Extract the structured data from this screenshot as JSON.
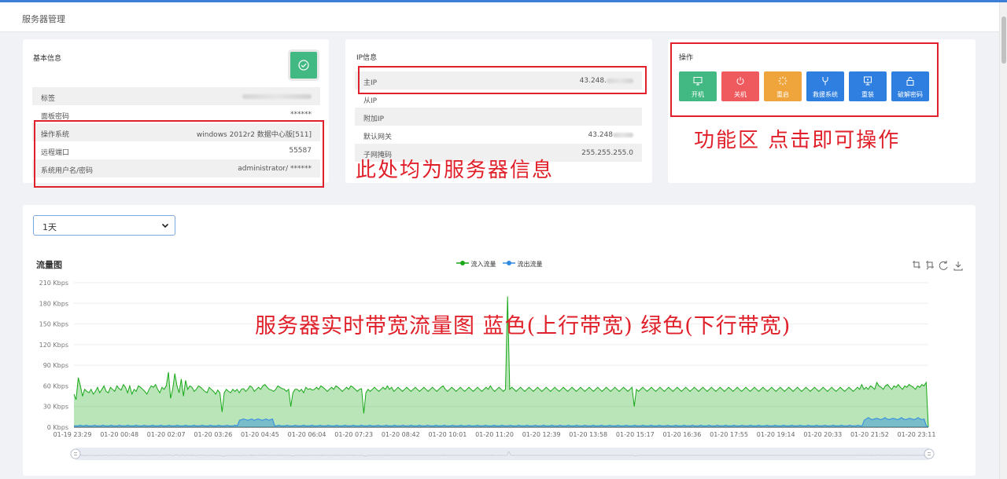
{
  "page": {
    "title": "服务器管理"
  },
  "basic_info": {
    "title": "基本信息",
    "rows": [
      {
        "label": "标签",
        "value": ""
      },
      {
        "label": "面板密码",
        "value": "******"
      },
      {
        "label": "操作系统",
        "value": "windows 2012r2 数据中心版[511]"
      },
      {
        "label": "远程端口",
        "value": "55587"
      },
      {
        "label": "系统用户名/密码",
        "value": "administrator/ ******"
      }
    ]
  },
  "ip_info": {
    "title": "IP信息",
    "rows": [
      {
        "label": "主IP",
        "value": "43.248."
      },
      {
        "label": "从IP",
        "value": ""
      },
      {
        "label": "附加IP",
        "value": ""
      },
      {
        "label": "默认网关",
        "value": "43.248"
      },
      {
        "label": "子网掩码",
        "value": "255.255.255.0"
      }
    ]
  },
  "operations": {
    "title": "操作",
    "buttons": [
      {
        "label": "开机",
        "color": "#42b983",
        "icon": "monitor-icon"
      },
      {
        "label": "关机",
        "color": "#ef5a5f",
        "icon": "power-icon"
      },
      {
        "label": "重启",
        "color": "#f0a43c",
        "icon": "spinner-icon"
      },
      {
        "label": "救援系统",
        "color": "#2f7fe0",
        "icon": "tool-icon"
      },
      {
        "label": "重装",
        "color": "#2f7fe0",
        "icon": "screen-icon"
      },
      {
        "label": "破解密码",
        "color": "#2f7fe0",
        "icon": "unlock-icon"
      }
    ]
  },
  "annotations": {
    "server_info": "此处均为服务器信息",
    "function_area": "功能区  点击即可操作",
    "bandwidth": "服务器实时带宽流量图 蓝色(上行带宽) 绿色(下行带宽)"
  },
  "range_select": {
    "value": "1天"
  },
  "chart_data": {
    "type": "area",
    "title": "流量图",
    "ylabel": "",
    "xlabel": "",
    "ylim": [
      0,
      210
    ],
    "y_unit": "Kbps",
    "y_ticks": [
      "0 Kbps",
      "30 Kbps",
      "60 Kbps",
      "90 Kbps",
      "120 Kbps",
      "150 Kbps",
      "180 Kbps",
      "210 Kbps"
    ],
    "x_ticks": [
      "01-19 23:29",
      "01-20 00:48",
      "01-20 02:07",
      "01-20 03:26",
      "01-20 04:45",
      "01-20 06:04",
      "01-20 07:23",
      "01-20 08:42",
      "01-20 10:01",
      "01-20 11:20",
      "01-20 12:39",
      "01-20 13:58",
      "01-20 15:17",
      "01-20 16:36",
      "01-20 17:55",
      "01-20 19:14",
      "01-20 20:33",
      "01-20 21:52",
      "01-20 23:11"
    ],
    "legend_position": "top-center",
    "series": [
      {
        "name": "流入流量",
        "color": "#18a818",
        "values": [
          48,
          40,
          72,
          60,
          45,
          55,
          52,
          50,
          55,
          48,
          52,
          58,
          50,
          55,
          60,
          52,
          50,
          58,
          55,
          52,
          60,
          56,
          54,
          62,
          58,
          50,
          60,
          48,
          55,
          52,
          60,
          58,
          55,
          52,
          48,
          55,
          60,
          58,
          62,
          55,
          50,
          58,
          55,
          60,
          80,
          42,
          55,
          78,
          60,
          50,
          70,
          45,
          68,
          55,
          60,
          58,
          52,
          55,
          60,
          58,
          55,
          52,
          50,
          58,
          55,
          52,
          48,
          54,
          50,
          22,
          50,
          55,
          52,
          50,
          55,
          52,
          55,
          50,
          55,
          56,
          52,
          55,
          60,
          58,
          52,
          55,
          58,
          55,
          60,
          62,
          58,
          55,
          54,
          52,
          55,
          60,
          58,
          56,
          55,
          52,
          55,
          30,
          50,
          55,
          55,
          52,
          55,
          50,
          58,
          55,
          56,
          54,
          55,
          58,
          55,
          60,
          58,
          55,
          52,
          55,
          58,
          55,
          60,
          58,
          55,
          52,
          55,
          58,
          55,
          60,
          58,
          55,
          52,
          55,
          56,
          20,
          50,
          55,
          52,
          55,
          58,
          55,
          52,
          55,
          58,
          55,
          60,
          55,
          58,
          52,
          55,
          58,
          55,
          52,
          55,
          58,
          55,
          52,
          55,
          58,
          55,
          52,
          55,
          58,
          55,
          52,
          55,
          58,
          55,
          52,
          55,
          58,
          60,
          55,
          52,
          55,
          58,
          55,
          52,
          55,
          58,
          55,
          52,
          55,
          58,
          55,
          52,
          55,
          58,
          55,
          52,
          55,
          58,
          55,
          60,
          55,
          52,
          55,
          58,
          55,
          52,
          55,
          190,
          55,
          58,
          55,
          52,
          55,
          58,
          55,
          52,
          55,
          58,
          55,
          52,
          55,
          58,
          55,
          52,
          55,
          58,
          55,
          52,
          55,
          58,
          55,
          52,
          55,
          58,
          55,
          52,
          55,
          58,
          55,
          52,
          55,
          58,
          55,
          52,
          55,
          58,
          55,
          52,
          55,
          58,
          55,
          52,
          55,
          58,
          55,
          52,
          55,
          58,
          55,
          52,
          55,
          58,
          55,
          52,
          55,
          58,
          30,
          55,
          52,
          55,
          58,
          55,
          52,
          55,
          58,
          55,
          52,
          55,
          58,
          55,
          52,
          55,
          58,
          55,
          52,
          55,
          58,
          55,
          52,
          55,
          58,
          55,
          52,
          55,
          58,
          55,
          52,
          55,
          58,
          55,
          52,
          55,
          58,
          55,
          52,
          55,
          58,
          55,
          52,
          55,
          58,
          55,
          52,
          55,
          58,
          55,
          52,
          55,
          58,
          55,
          52,
          55,
          58,
          55,
          52,
          55,
          58,
          55,
          52,
          55,
          58,
          55,
          52,
          55,
          58,
          55,
          52,
          55,
          58,
          55,
          52,
          55,
          58,
          55,
          52,
          55,
          58,
          55,
          52,
          55,
          58,
          55,
          52,
          55,
          58,
          55,
          52,
          55,
          58,
          55,
          52,
          55,
          58,
          55,
          52,
          55,
          58,
          55,
          52,
          55,
          58,
          55,
          62,
          55,
          58,
          55,
          60,
          58,
          55,
          65,
          60,
          58,
          55,
          60,
          62,
          58,
          55,
          60,
          58,
          62,
          58,
          55,
          60,
          58,
          62,
          60,
          58,
          55,
          60,
          58,
          62,
          60,
          65,
          0
        ]
      },
      {
        "name": "流出流量",
        "color": "#2f8be0",
        "values": [
          2,
          2,
          2,
          3,
          2,
          2,
          3,
          2,
          2,
          2,
          3,
          2,
          2,
          2,
          3,
          2,
          2,
          2,
          3,
          2,
          2,
          2,
          3,
          2,
          2,
          2,
          3,
          2,
          2,
          2,
          3,
          2,
          2,
          2,
          3,
          2,
          2,
          2,
          3,
          2,
          2,
          2,
          3,
          2,
          2,
          2,
          3,
          2,
          2,
          2,
          3,
          2,
          2,
          2,
          3,
          2,
          2,
          2,
          3,
          2,
          2,
          2,
          3,
          2,
          2,
          2,
          3,
          2,
          2,
          2,
          3,
          2,
          2,
          2,
          3,
          2,
          2,
          2,
          3,
          2,
          10,
          11,
          12,
          11,
          10,
          11,
          12,
          10,
          11,
          12,
          11,
          10,
          11,
          12,
          10,
          11,
          12,
          2,
          2,
          3,
          2,
          2,
          2,
          3,
          2,
          2,
          2,
          3,
          2,
          2,
          2,
          3,
          2,
          2,
          2,
          3,
          2,
          2,
          2,
          3,
          2,
          2,
          2,
          3,
          2,
          2,
          2,
          3,
          2,
          2,
          2,
          3,
          2,
          2,
          2,
          3,
          2,
          2,
          2,
          3,
          2,
          2,
          2,
          3,
          2,
          2,
          2,
          3,
          2,
          2,
          2,
          3,
          2,
          2,
          2,
          3,
          2,
          2,
          2,
          3,
          2,
          2,
          2,
          3,
          2,
          2,
          2,
          3,
          2,
          2,
          2,
          3,
          2,
          2,
          2,
          3,
          2,
          2,
          2,
          3,
          2,
          2,
          2,
          3,
          2,
          2,
          2,
          3,
          2,
          2,
          2,
          3,
          2,
          2,
          2,
          3,
          2,
          2,
          2,
          3,
          2,
          2,
          2,
          3,
          2,
          2,
          2,
          3,
          2,
          2,
          2,
          3,
          2,
          2,
          2,
          3,
          2,
          2,
          2,
          3,
          2,
          2,
          2,
          3,
          2,
          2,
          2,
          3,
          2,
          2,
          2,
          3,
          2,
          2,
          2,
          3,
          2,
          2,
          2,
          3,
          2,
          2,
          2,
          3,
          2,
          2,
          2,
          3,
          2,
          2,
          2,
          3,
          2,
          2,
          2,
          3,
          2,
          2,
          2,
          3,
          2,
          2,
          2,
          3,
          2,
          2,
          2,
          3,
          2,
          2,
          2,
          3,
          2,
          2,
          2,
          3,
          2,
          2,
          2,
          3,
          2,
          2,
          2,
          3,
          2,
          2,
          2,
          3,
          2,
          2,
          2,
          3,
          2,
          2,
          2,
          3,
          2,
          2,
          2,
          3,
          2,
          2,
          2,
          3,
          2,
          2,
          2,
          3,
          2,
          2,
          2,
          3,
          2,
          2,
          2,
          3,
          2,
          2,
          2,
          3,
          2,
          2,
          2,
          3,
          2,
          2,
          2,
          3,
          2,
          2,
          2,
          3,
          2,
          2,
          2,
          3,
          2,
          2,
          2,
          3,
          2,
          2,
          2,
          3,
          2,
          2,
          2,
          3,
          2,
          2,
          2,
          3,
          2,
          2,
          2,
          3,
          2,
          2,
          2,
          3,
          2,
          2,
          2,
          3,
          2,
          2,
          2,
          3,
          2,
          2,
          2,
          3,
          2,
          2,
          2,
          3,
          2,
          2,
          2,
          3,
          2,
          2,
          10,
          12,
          14,
          12,
          11,
          12,
          13,
          12,
          11,
          12,
          14,
          12,
          11,
          12,
          13,
          12,
          11,
          12,
          14,
          12,
          11,
          12,
          13,
          12,
          11,
          12,
          14,
          12,
          11,
          12,
          2,
          0
        ]
      }
    ]
  }
}
